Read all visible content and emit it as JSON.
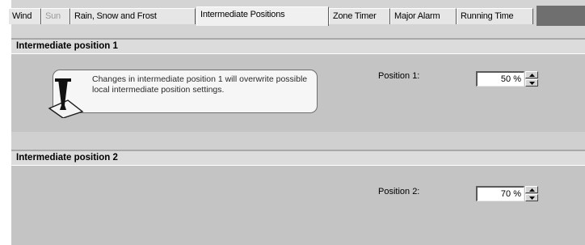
{
  "tabs": [
    {
      "label": "Wind",
      "state": "normal"
    },
    {
      "label": "Sun",
      "state": "disabled"
    },
    {
      "label": "Rain, Snow and Frost",
      "state": "normal"
    },
    {
      "label": "Intermediate Positions",
      "state": "active"
    },
    {
      "label": "Zone Timer",
      "state": "normal"
    },
    {
      "label": "Major Alarm",
      "state": "normal"
    },
    {
      "label": "Running Time",
      "state": "normal"
    }
  ],
  "section1": {
    "title": "Intermediate position 1",
    "notice": "Changes in intermediate position 1 will overwrite possible local intermediate position settings.",
    "notice_icon": "warning-exclamation-icon",
    "position_label": "Position 1:",
    "position_value": "50 %"
  },
  "section2": {
    "title": "Intermediate position 2",
    "position_label": "Position 2:",
    "position_value": "70 %"
  },
  "colors": {
    "panel": "#c4c4c4",
    "header": "#dcdcdc",
    "tab_strip_end": "#6f6f6f"
  }
}
